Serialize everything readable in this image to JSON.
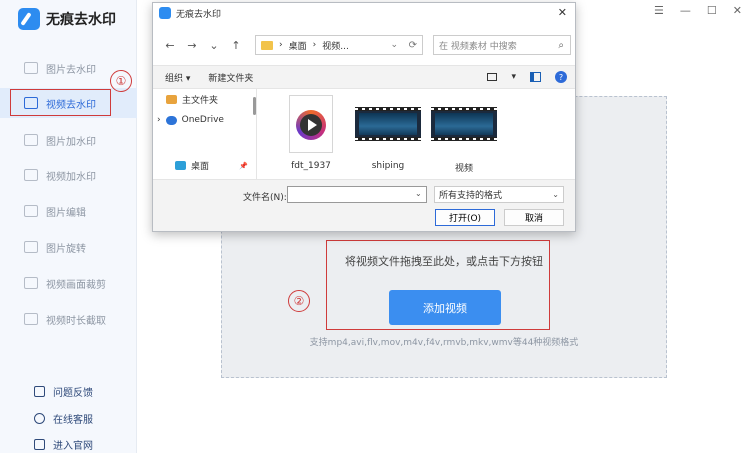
{
  "app": {
    "title": "无痕去水印",
    "window_controls": {
      "menu": "☰",
      "minimize": "—",
      "maximize": "☐",
      "close": "✕"
    }
  },
  "sidebar": {
    "items": [
      {
        "label": "图片去水印",
        "active": false
      },
      {
        "label": "视频去水印",
        "active": true
      },
      {
        "label": "图片加水印",
        "active": false
      },
      {
        "label": "视频加水印",
        "active": false
      },
      {
        "label": "图片编辑",
        "active": false
      },
      {
        "label": "图片旋转",
        "active": false
      },
      {
        "label": "视频画面裁剪",
        "active": false
      },
      {
        "label": "视频时长截取",
        "active": false
      }
    ],
    "footer": [
      {
        "label": "问题反馈",
        "icon": "feedback-icon"
      },
      {
        "label": "在线客服",
        "icon": "customer-service-icon"
      },
      {
        "label": "进入官网",
        "icon": "website-icon"
      }
    ]
  },
  "annotations": {
    "step1": "①",
    "step2": "②"
  },
  "main": {
    "drop_hint": "将视频文件拖拽至此处，或点击下方按钮",
    "add_button": "添加视频",
    "formats": "支持mp4,avi,flv,mov,m4v,f4v,rmvb,mkv,wmv等44种视频格式"
  },
  "dialog": {
    "title": "无痕去水印",
    "close": "✕",
    "nav": {
      "back": "←",
      "forward": "→",
      "dropdown": "⌄",
      "up": "↑"
    },
    "address": {
      "sep": "›",
      "crumbs": [
        "桌面",
        "视频..."
      ],
      "chevron": "⌄",
      "refresh": "⟳"
    },
    "search_placeholder": "在 视频素材 中搜索",
    "search_icon": "⌕",
    "toolbar": {
      "organize": "组织 ▾",
      "new_folder": "新建文件夹",
      "view_arrow": "▾",
      "help": "?"
    },
    "tree": [
      {
        "label": "主文件夹",
        "color": "#e8a33d",
        "expander": ""
      },
      {
        "label": "OneDrive",
        "color": "#2d74d8",
        "expander": "›"
      },
      {
        "label": "桌面",
        "color": "#2d9fd8",
        "expander": "",
        "pin": "📌"
      }
    ],
    "files": [
      {
        "name": "fdt_1937",
        "kind": "media-file"
      },
      {
        "name": "shiping",
        "kind": "video"
      },
      {
        "name": "视频",
        "kind": "video"
      }
    ],
    "filename_label": "文件名(N):",
    "filename_value": "",
    "filename_chevron": "⌄",
    "filetype": "所有支持的格式",
    "filetype_chevron": "⌄",
    "open_button": "打开(O)",
    "cancel_button": "取消"
  }
}
